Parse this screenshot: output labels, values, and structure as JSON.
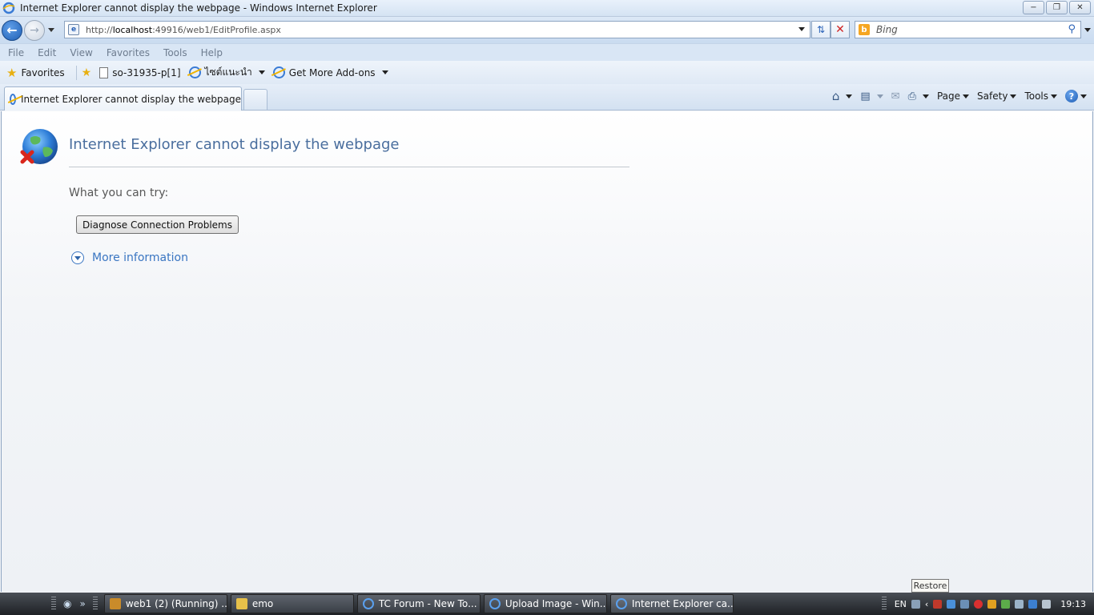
{
  "window": {
    "title": "Internet Explorer cannot display the webpage - Windows Internet Explorer",
    "minimize": "−",
    "restore": "❐",
    "close": "✕"
  },
  "address_bar": {
    "url_prefix": "http://",
    "url_host": "localhost",
    "url_rest": ":49916/web1/EditProfile.aspx"
  },
  "search": {
    "placeholder": "Bing"
  },
  "menu": {
    "items": [
      "File",
      "Edit",
      "View",
      "Favorites",
      "Tools",
      "Help"
    ]
  },
  "favorites_bar": {
    "favorites_label": "Favorites",
    "items": [
      {
        "label": "so-31935-p[1]"
      },
      {
        "label": "ไซต์แนะนำ"
      },
      {
        "label": "Get More Add-ons"
      }
    ]
  },
  "tabs": {
    "active_label": "Internet Explorer cannot display the webpage"
  },
  "command_bar": {
    "page": "Page",
    "safety": "Safety",
    "tools": "Tools",
    "help": "?"
  },
  "error_page": {
    "title": "Internet Explorer cannot display the webpage",
    "try_label": "What you can try:",
    "diagnose_button": "Diagnose Connection Problems",
    "more_info": "More information"
  },
  "tooltip": "Restore",
  "taskbar": {
    "tasks": [
      {
        "label": "web1 (2) (Running) ...",
        "icon": "visual-studio-icon"
      },
      {
        "label": "emo",
        "icon": "folder-icon"
      },
      {
        "label": "TC Forum - New To...",
        "icon": "ie-icon"
      },
      {
        "label": "Upload Image - Win...",
        "icon": "ie-icon"
      },
      {
        "label": "Internet Explorer ca...",
        "icon": "ie-icon"
      }
    ],
    "language": "EN",
    "clock": "19:13"
  },
  "colors": {
    "error_title": "#4a6e9e",
    "link": "#3a76c2",
    "taskbar": "#2a2e33"
  }
}
